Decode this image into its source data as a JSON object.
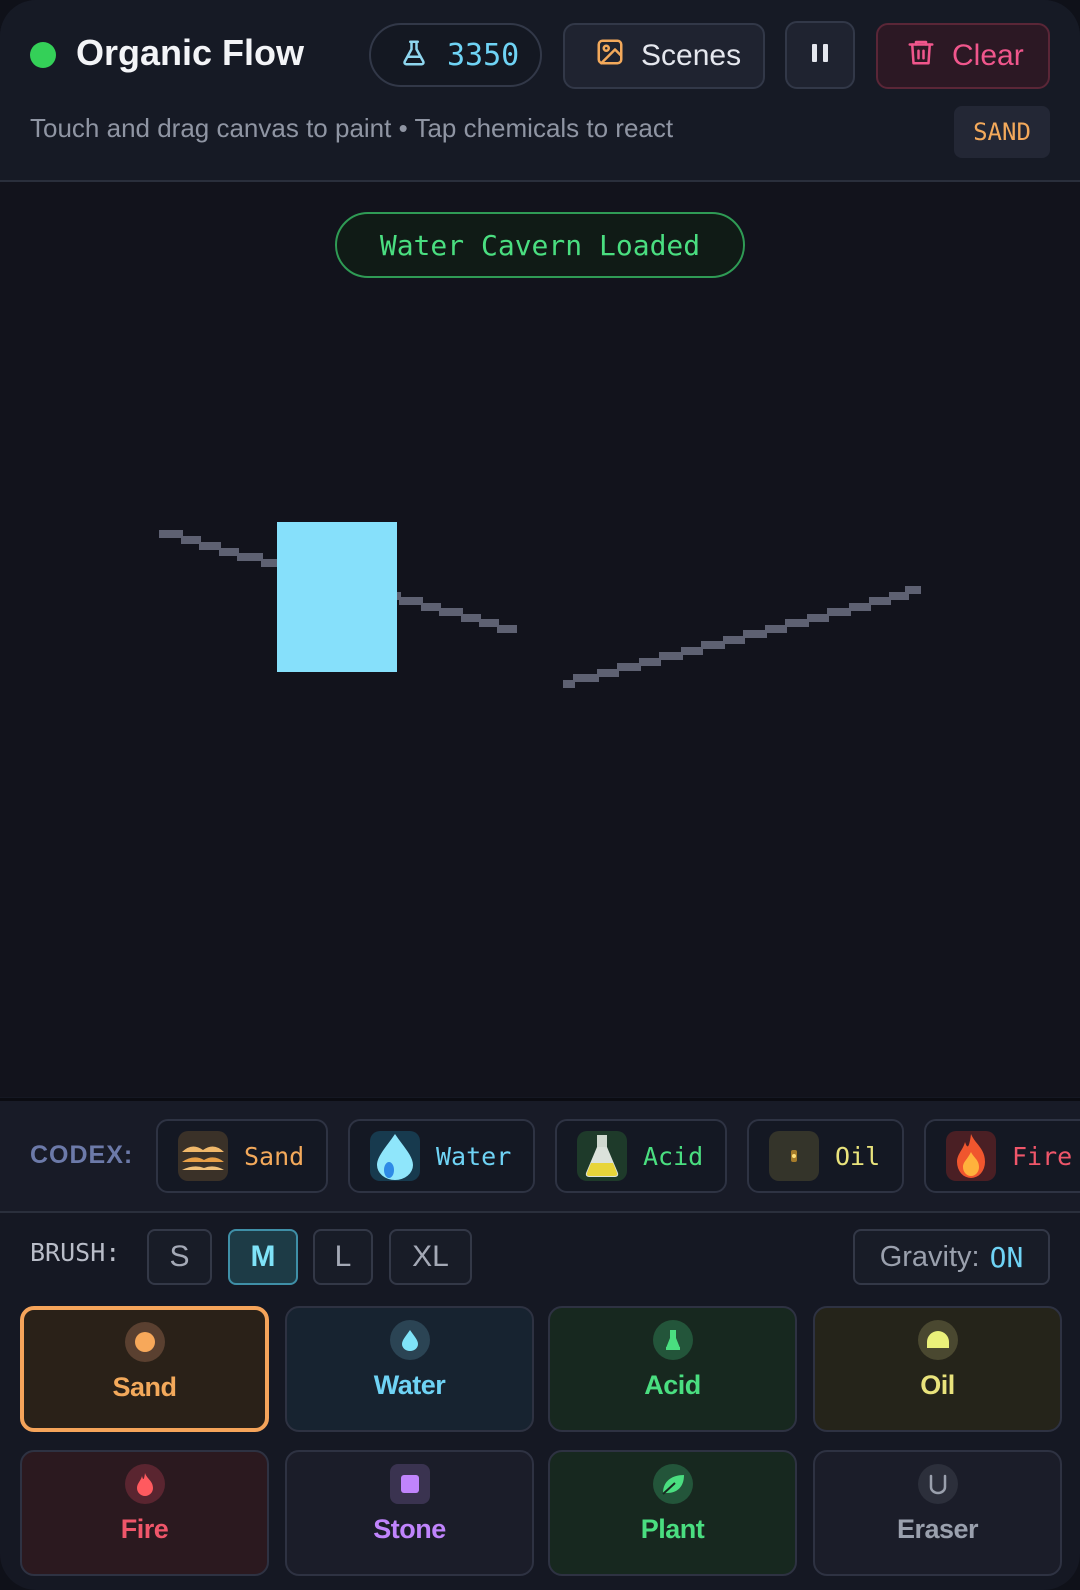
{
  "header": {
    "title": "Organic Flow",
    "particle_count": "3350",
    "scenes_label": "Scenes",
    "clear_label": "Clear",
    "hint": "Touch and drag canvas to paint • Tap chemicals to react",
    "current_material": "SAND"
  },
  "canvas": {
    "toast": "Water Cavern Loaded"
  },
  "codex": {
    "label": "CODEX:",
    "items": [
      {
        "name": "Sand",
        "color": "#f3a95b"
      },
      {
        "name": "Water",
        "color": "#6fd3f5"
      },
      {
        "name": "Acid",
        "color": "#4ade80"
      },
      {
        "name": "Oil",
        "color": "#e9e37c"
      },
      {
        "name": "Fire",
        "color": "#f0566a"
      }
    ]
  },
  "brush": {
    "label": "BRUSH:",
    "sizes": [
      "S",
      "M",
      "L",
      "XL"
    ],
    "selected": "M",
    "gravity_label": "Gravity:",
    "gravity_value": "ON"
  },
  "materials": [
    {
      "label": "Sand",
      "icon": "sand-grain-icon",
      "color": "#f3a95b",
      "selected": true
    },
    {
      "label": "Water",
      "icon": "water-drop-icon",
      "color": "#6fd3f5",
      "selected": false
    },
    {
      "label": "Acid",
      "icon": "flask-icon",
      "color": "#4ade80",
      "selected": false
    },
    {
      "label": "Oil",
      "icon": "oil-dome-icon",
      "color": "#e9e37c",
      "selected": false
    },
    {
      "label": "Fire",
      "icon": "flame-icon",
      "color": "#f0566a",
      "selected": false
    },
    {
      "label": "Stone",
      "icon": "stone-square-icon",
      "color": "#c084fc",
      "selected": false
    },
    {
      "label": "Plant",
      "icon": "leaf-icon",
      "color": "#4ade80",
      "selected": false
    },
    {
      "label": "Eraser",
      "icon": "eraser-cup-icon",
      "color": "#9aa0ad",
      "selected": false
    }
  ]
}
